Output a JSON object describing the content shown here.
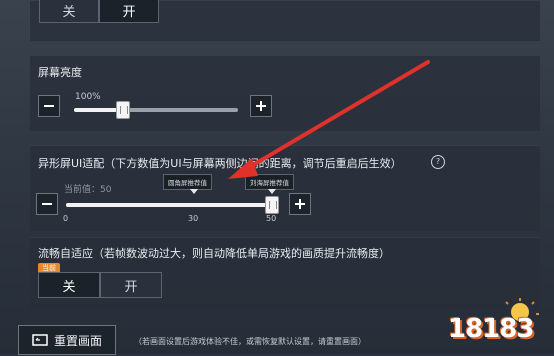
{
  "toggle_top": {
    "off_label": "关",
    "on_label": "开"
  },
  "brightness": {
    "title": "屏幕亮度",
    "value_label": "100%",
    "level": 0.3,
    "minus_icon": "minus-icon",
    "plus_icon": "plus-icon"
  },
  "notch": {
    "title": "异形屏UI适配（下方数值为UI与屏幕两侧边间的距离，调节后重启后生效）",
    "help_icon": "question-circle-icon",
    "current_label": "当前值：50",
    "tip_left": "圆角屏推荐值",
    "tip_right": "刘海屏推荐值",
    "ticks": [
      "0",
      "30",
      "50"
    ],
    "value": 50,
    "min": 0,
    "max": 50
  },
  "adaptive": {
    "title": "流畅自适应（若帧数波动过大，则自动降低单局游戏的画质提升流畅度）",
    "badge": "当前",
    "off_label": "关",
    "on_label": "开"
  },
  "reset": {
    "button_label": "重置画面",
    "icon": "reset-screen-icon",
    "note": "（若画面设置后游戏体验不佳，或需恢复默认设置，请重置画面）"
  },
  "watermark": {
    "text": "18183"
  },
  "colors": {
    "arrow": "#e0312b",
    "badge": "#e48a2c",
    "panel": "#2b3340"
  }
}
